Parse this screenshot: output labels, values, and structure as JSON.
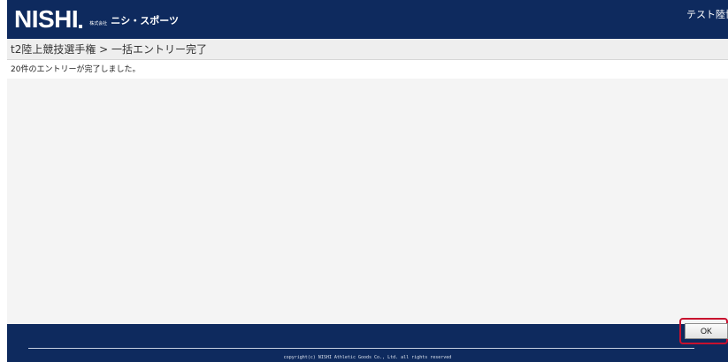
{
  "header": {
    "brand": "NISHI",
    "corp_tag": "株式会社",
    "brand_subtitle": "ニシ・スポーツ",
    "user_name": "テスト陸協"
  },
  "breadcrumb": {
    "text": "t2陸上競技選手権 > 一括エントリー完了"
  },
  "message": {
    "text": "20件のエントリーが完了しました。"
  },
  "footer": {
    "ok_label": "OK",
    "copyright": "copyright(c) NISHI Athletic Goods Co., Ltd. all rights reserved"
  },
  "colors": {
    "header_bg": "#0e2a5e",
    "footer_bg": "#0e2a5e",
    "highlight": "#c8102e"
  }
}
